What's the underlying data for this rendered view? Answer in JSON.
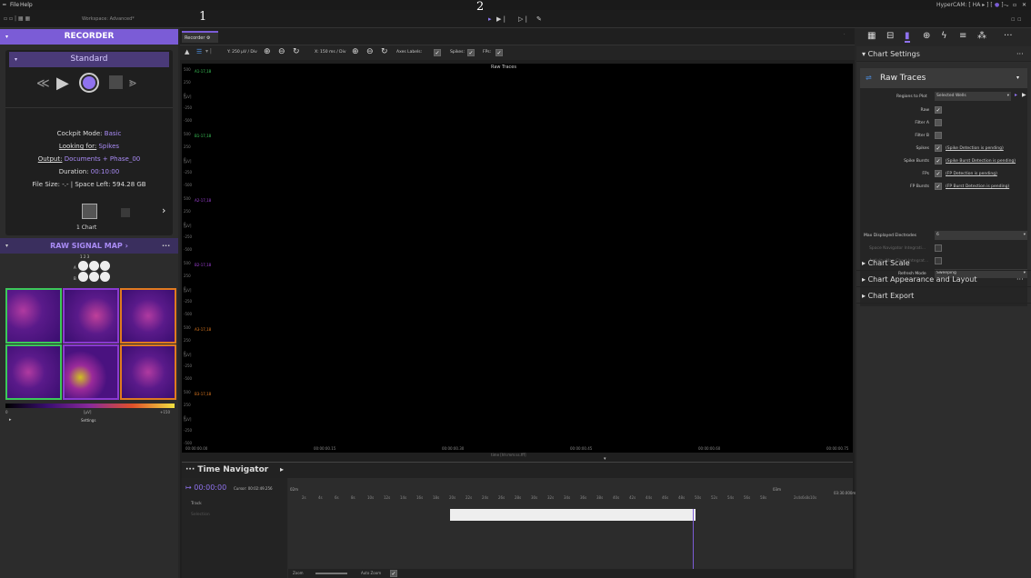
{
  "menu": {
    "file": "File",
    "help": "Help",
    "workspace": "Workspace: Advanced*",
    "app_title": "HyperCAM: [ HA ▸ ] [ ··· ] ⌄"
  },
  "annotations": {
    "a1": "1",
    "a2": "2"
  },
  "recorder": {
    "title": "RECORDER",
    "mode": "Standard",
    "cockpit_label": "Cockpit Mode:",
    "cockpit_value": "Basic",
    "looking_label": "Looking for:",
    "looking_value": "Spikes",
    "output_label": "Output:",
    "output_value": "Documents + Phase_00",
    "duration_label": "Duration:",
    "duration_value": "00:10:00",
    "filesize": "File Size: -.- | Space Left: 594.28 GB",
    "chart_button": "1 Chart"
  },
  "raw_signal_map": {
    "title": "RAW SIGNAL MAP",
    "cols": "1  2  3",
    "row_a": "A",
    "row_b": "B",
    "scale_min": "0",
    "scale_unit": "[µV]",
    "scale_max": "+150",
    "settings": "Settings"
  },
  "tab": {
    "label": "Recorder"
  },
  "toolbar": {
    "ydiv": "Y: 250 µV / Div",
    "xdiv": "X: 150 ms / Div",
    "axes_labels": "Axes Labels:",
    "spikes": "Spikes:",
    "fps": "FPs:"
  },
  "plot": {
    "title": "Raw Traces",
    "xlabel": "time [hh:mm:ss.fff]",
    "unit": "[µV]",
    "x_ticks": [
      "00:00:00.00",
      "00:00:00.15",
      "00:00:00.30",
      "00:00:00.45",
      "00:00:00.60",
      "00:00:00.75"
    ],
    "traces": [
      {
        "label": "A1-17,18",
        "color": "#3cc85a",
        "ticks": [
          "500",
          "250",
          "0",
          "-250",
          "-500"
        ]
      },
      {
        "label": "B1-17,18",
        "color": "#3cc85a",
        "ticks": [
          "500",
          "250",
          "0",
          "-250",
          "-500"
        ]
      },
      {
        "label": "A2-17,18",
        "color": "#a040d8",
        "ticks": [
          "500",
          "250",
          "0",
          "-250",
          "-500"
        ]
      },
      {
        "label": "B2-17,18",
        "color": "#a040d8",
        "ticks": [
          "500",
          "250",
          "0",
          "-250",
          "-500"
        ]
      },
      {
        "label": "A3-17,18",
        "color": "#e07a20",
        "ticks": [
          "500",
          "250",
          "0",
          "-250",
          "-500"
        ]
      },
      {
        "label": "B3-17,18",
        "color": "#e07a20",
        "ticks": [
          "500",
          "250",
          "0",
          "-250",
          "-500"
        ]
      }
    ]
  },
  "time_nav": {
    "title": "··· Time Navigator",
    "time": "00:00:00",
    "cursor": "Cursor: 00:02:49.256",
    "track": "Track",
    "selection": "Selection",
    "zoom": "Zoom",
    "auto_zoom": "Auto Zoom",
    "t02": "02m",
    "t03": "03m",
    "t_end": "03:30.000m",
    "seconds": [
      "2s",
      "4s",
      "6s",
      "8s",
      "10s",
      "12s",
      "14s",
      "16s",
      "18s",
      "20s",
      "22s",
      "24s",
      "26s",
      "28s",
      "30s",
      "32s",
      "34s",
      "36s",
      "38s",
      "40s",
      "42s",
      "44s",
      "46s",
      "48s",
      "50s",
      "52s",
      "54s",
      "56s",
      "58s"
    ],
    "seconds2": [
      "2s",
      "4s",
      "6s",
      "8s",
      "10s",
      "12s",
      "14s",
      "16s",
      "18s",
      "20s",
      "22s",
      "24s",
      "26s",
      "28s"
    ]
  },
  "chart_settings": {
    "header": "Chart Settings",
    "dropdown": "Raw Traces",
    "regions_label": "Regions to Plot",
    "regions_value": "Selected Wells",
    "rows": [
      {
        "label": "Raw",
        "checked": "✓",
        "note": ""
      },
      {
        "label": "Filter A",
        "checked": "",
        "note": ""
      },
      {
        "label": "Filter B",
        "checked": "",
        "note": ""
      },
      {
        "label": "Spikes",
        "checked": "✓",
        "note": "(Spike Detection is pending)"
      },
      {
        "label": "Spike Bursts",
        "checked": "✓",
        "note": "(Spike Burst Detection is pending)"
      },
      {
        "label": "FPs",
        "checked": "✓",
        "note": "(FP Detection is pending)"
      },
      {
        "label": "FP Bursts",
        "checked": "✓",
        "note": "(FP Burst Detection is pending)"
      }
    ],
    "max_label": "Max Displayed Electrodes",
    "max_value": "6",
    "space_nav": "Space Navigator Integrati...",
    "activity_map": "Activity Map Chart Integrat...",
    "refresh_label": "Refresh Mode",
    "refresh_value": "Sweeping",
    "sections": [
      "Chart Scale",
      "Chart Appearance and Layout",
      "Chart Export"
    ]
  }
}
